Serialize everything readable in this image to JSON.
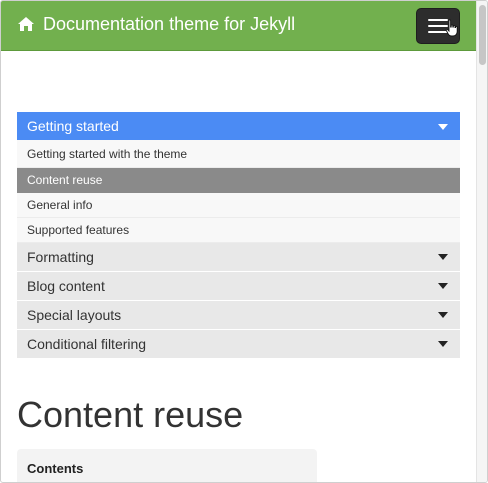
{
  "navbar": {
    "brand": "Documentation theme for Jekyll",
    "icons": {
      "home": "home-icon",
      "menu": "hamburger-menu-icon",
      "cursor": "hand-pointer-icon"
    }
  },
  "sidebar": {
    "active_section": {
      "label": "Getting started",
      "items": [
        {
          "label": "Getting started with the theme",
          "active": false
        },
        {
          "label": "Content reuse",
          "active": true
        },
        {
          "label": "General info",
          "active": false
        },
        {
          "label": "Supported features",
          "active": false
        }
      ]
    },
    "sections": [
      {
        "label": "Formatting"
      },
      {
        "label": "Blog content"
      },
      {
        "label": "Special layouts"
      },
      {
        "label": "Conditional filtering"
      }
    ]
  },
  "main": {
    "title": "Content reuse",
    "toc": {
      "title": "Contents"
    }
  },
  "colors": {
    "navbar": "#72b04e",
    "active_section": "#4b8bf4",
    "active_item": "#8a8a8a",
    "section": "#e8e8e8"
  }
}
